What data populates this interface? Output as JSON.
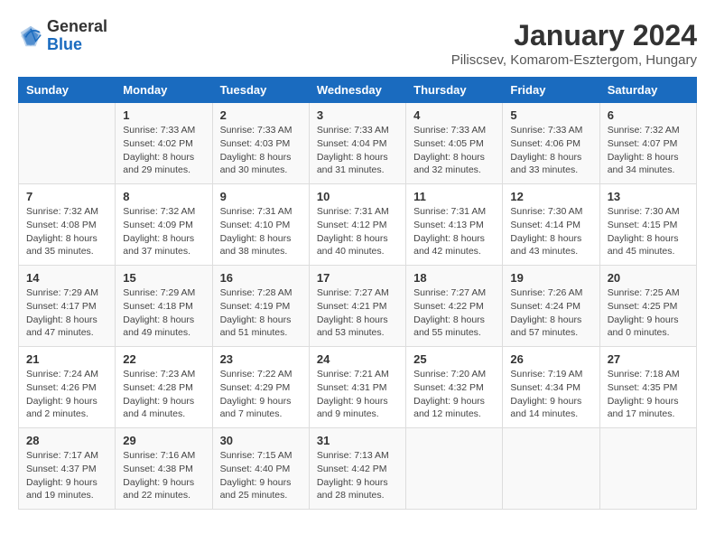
{
  "logo": {
    "general": "General",
    "blue": "Blue"
  },
  "header": {
    "title": "January 2024",
    "subtitle": "Piliscsev, Komarom-Esztergom, Hungary"
  },
  "weekdays": [
    "Sunday",
    "Monday",
    "Tuesday",
    "Wednesday",
    "Thursday",
    "Friday",
    "Saturday"
  ],
  "weeks": [
    [
      {
        "day": "",
        "sunrise": "",
        "sunset": "",
        "daylight": ""
      },
      {
        "day": "1",
        "sunrise": "Sunrise: 7:33 AM",
        "sunset": "Sunset: 4:02 PM",
        "daylight": "Daylight: 8 hours and 29 minutes."
      },
      {
        "day": "2",
        "sunrise": "Sunrise: 7:33 AM",
        "sunset": "Sunset: 4:03 PM",
        "daylight": "Daylight: 8 hours and 30 minutes."
      },
      {
        "day": "3",
        "sunrise": "Sunrise: 7:33 AM",
        "sunset": "Sunset: 4:04 PM",
        "daylight": "Daylight: 8 hours and 31 minutes."
      },
      {
        "day": "4",
        "sunrise": "Sunrise: 7:33 AM",
        "sunset": "Sunset: 4:05 PM",
        "daylight": "Daylight: 8 hours and 32 minutes."
      },
      {
        "day": "5",
        "sunrise": "Sunrise: 7:33 AM",
        "sunset": "Sunset: 4:06 PM",
        "daylight": "Daylight: 8 hours and 33 minutes."
      },
      {
        "day": "6",
        "sunrise": "Sunrise: 7:32 AM",
        "sunset": "Sunset: 4:07 PM",
        "daylight": "Daylight: 8 hours and 34 minutes."
      }
    ],
    [
      {
        "day": "7",
        "sunrise": "Sunrise: 7:32 AM",
        "sunset": "Sunset: 4:08 PM",
        "daylight": "Daylight: 8 hours and 35 minutes."
      },
      {
        "day": "8",
        "sunrise": "Sunrise: 7:32 AM",
        "sunset": "Sunset: 4:09 PM",
        "daylight": "Daylight: 8 hours and 37 minutes."
      },
      {
        "day": "9",
        "sunrise": "Sunrise: 7:31 AM",
        "sunset": "Sunset: 4:10 PM",
        "daylight": "Daylight: 8 hours and 38 minutes."
      },
      {
        "day": "10",
        "sunrise": "Sunrise: 7:31 AM",
        "sunset": "Sunset: 4:12 PM",
        "daylight": "Daylight: 8 hours and 40 minutes."
      },
      {
        "day": "11",
        "sunrise": "Sunrise: 7:31 AM",
        "sunset": "Sunset: 4:13 PM",
        "daylight": "Daylight: 8 hours and 42 minutes."
      },
      {
        "day": "12",
        "sunrise": "Sunrise: 7:30 AM",
        "sunset": "Sunset: 4:14 PM",
        "daylight": "Daylight: 8 hours and 43 minutes."
      },
      {
        "day": "13",
        "sunrise": "Sunrise: 7:30 AM",
        "sunset": "Sunset: 4:15 PM",
        "daylight": "Daylight: 8 hours and 45 minutes."
      }
    ],
    [
      {
        "day": "14",
        "sunrise": "Sunrise: 7:29 AM",
        "sunset": "Sunset: 4:17 PM",
        "daylight": "Daylight: 8 hours and 47 minutes."
      },
      {
        "day": "15",
        "sunrise": "Sunrise: 7:29 AM",
        "sunset": "Sunset: 4:18 PM",
        "daylight": "Daylight: 8 hours and 49 minutes."
      },
      {
        "day": "16",
        "sunrise": "Sunrise: 7:28 AM",
        "sunset": "Sunset: 4:19 PM",
        "daylight": "Daylight: 8 hours and 51 minutes."
      },
      {
        "day": "17",
        "sunrise": "Sunrise: 7:27 AM",
        "sunset": "Sunset: 4:21 PM",
        "daylight": "Daylight: 8 hours and 53 minutes."
      },
      {
        "day": "18",
        "sunrise": "Sunrise: 7:27 AM",
        "sunset": "Sunset: 4:22 PM",
        "daylight": "Daylight: 8 hours and 55 minutes."
      },
      {
        "day": "19",
        "sunrise": "Sunrise: 7:26 AM",
        "sunset": "Sunset: 4:24 PM",
        "daylight": "Daylight: 8 hours and 57 minutes."
      },
      {
        "day": "20",
        "sunrise": "Sunrise: 7:25 AM",
        "sunset": "Sunset: 4:25 PM",
        "daylight": "Daylight: 9 hours and 0 minutes."
      }
    ],
    [
      {
        "day": "21",
        "sunrise": "Sunrise: 7:24 AM",
        "sunset": "Sunset: 4:26 PM",
        "daylight": "Daylight: 9 hours and 2 minutes."
      },
      {
        "day": "22",
        "sunrise": "Sunrise: 7:23 AM",
        "sunset": "Sunset: 4:28 PM",
        "daylight": "Daylight: 9 hours and 4 minutes."
      },
      {
        "day": "23",
        "sunrise": "Sunrise: 7:22 AM",
        "sunset": "Sunset: 4:29 PM",
        "daylight": "Daylight: 9 hours and 7 minutes."
      },
      {
        "day": "24",
        "sunrise": "Sunrise: 7:21 AM",
        "sunset": "Sunset: 4:31 PM",
        "daylight": "Daylight: 9 hours and 9 minutes."
      },
      {
        "day": "25",
        "sunrise": "Sunrise: 7:20 AM",
        "sunset": "Sunset: 4:32 PM",
        "daylight": "Daylight: 9 hours and 12 minutes."
      },
      {
        "day": "26",
        "sunrise": "Sunrise: 7:19 AM",
        "sunset": "Sunset: 4:34 PM",
        "daylight": "Daylight: 9 hours and 14 minutes."
      },
      {
        "day": "27",
        "sunrise": "Sunrise: 7:18 AM",
        "sunset": "Sunset: 4:35 PM",
        "daylight": "Daylight: 9 hours and 17 minutes."
      }
    ],
    [
      {
        "day": "28",
        "sunrise": "Sunrise: 7:17 AM",
        "sunset": "Sunset: 4:37 PM",
        "daylight": "Daylight: 9 hours and 19 minutes."
      },
      {
        "day": "29",
        "sunrise": "Sunrise: 7:16 AM",
        "sunset": "Sunset: 4:38 PM",
        "daylight": "Daylight: 9 hours and 22 minutes."
      },
      {
        "day": "30",
        "sunrise": "Sunrise: 7:15 AM",
        "sunset": "Sunset: 4:40 PM",
        "daylight": "Daylight: 9 hours and 25 minutes."
      },
      {
        "day": "31",
        "sunrise": "Sunrise: 7:13 AM",
        "sunset": "Sunset: 4:42 PM",
        "daylight": "Daylight: 9 hours and 28 minutes."
      },
      {
        "day": "",
        "sunrise": "",
        "sunset": "",
        "daylight": ""
      },
      {
        "day": "",
        "sunrise": "",
        "sunset": "",
        "daylight": ""
      },
      {
        "day": "",
        "sunrise": "",
        "sunset": "",
        "daylight": ""
      }
    ]
  ]
}
